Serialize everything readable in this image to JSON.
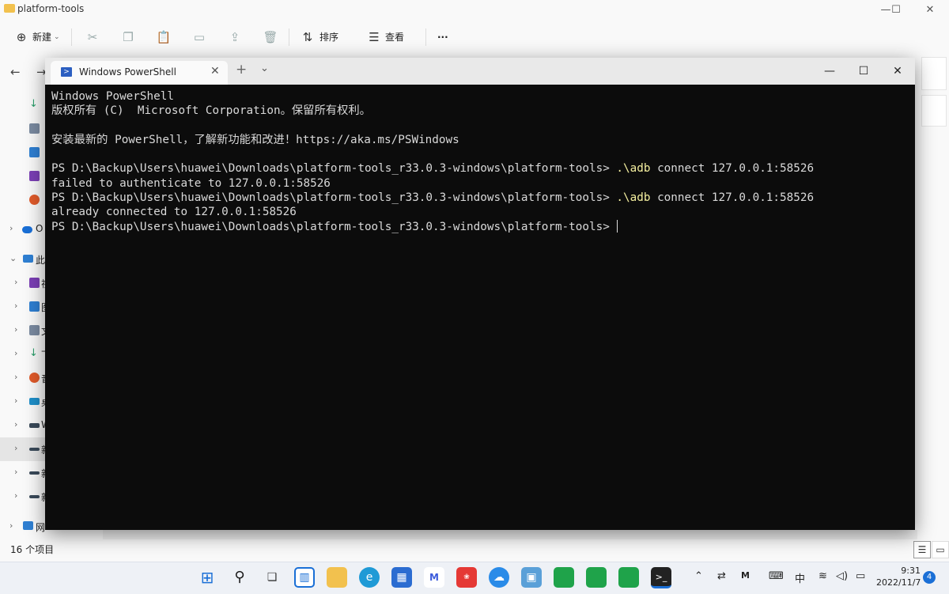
{
  "explorer": {
    "title": "platform-tools",
    "window_controls": {
      "minimize": "—",
      "maximize": "☐",
      "close": "✕"
    },
    "commands": {
      "new_label": "新建",
      "sort_label": "排序",
      "view_label": "查看",
      "more_label": "···"
    },
    "sidebar": {
      "onedrive_label": "O",
      "thispc_label": "此",
      "items": [
        {
          "label": "视"
        },
        {
          "label": "图"
        },
        {
          "label": "文"
        },
        {
          "label": "下"
        },
        {
          "label": "音"
        },
        {
          "label": "桌"
        },
        {
          "label": "W"
        },
        {
          "label": "新"
        },
        {
          "label": "新"
        },
        {
          "label": "新"
        }
      ],
      "network_label": "网"
    },
    "status": {
      "item_count": "16 个项目"
    }
  },
  "terminal": {
    "tab_title": "Windows PowerShell",
    "new_tab": "+",
    "lines": {
      "l1": "Windows PowerShell",
      "l2": "版权所有 (C)  Microsoft Corporation。保留所有权利。",
      "l3": "安装最新的 PowerShell，了解新功能和改进！https://aka.ms/PSWindows",
      "prompt": "PS D:\\Backup\\Users\\huawei\\Downloads\\platform-tools_r33.0.3-windows\\platform-tools> ",
      "cmd_exe": ".\\adb",
      "cmd_args": " connect 127.0.0.1:58526",
      "out1": "failed to authenticate to 127.0.0.1:58526",
      "out2": "already connected to 127.0.0.1:58526"
    }
  },
  "taskbar": {
    "tray": {
      "ime": "中"
    },
    "clock": {
      "time": "9:31",
      "date": "2022/11/7"
    },
    "notifications": "4"
  },
  "colors": {
    "terminal_bg": "#0c0c0c",
    "terminal_text": "#d9d9d9",
    "command_highlight": "#f5f0a0",
    "accent": "#1a6fd6"
  }
}
